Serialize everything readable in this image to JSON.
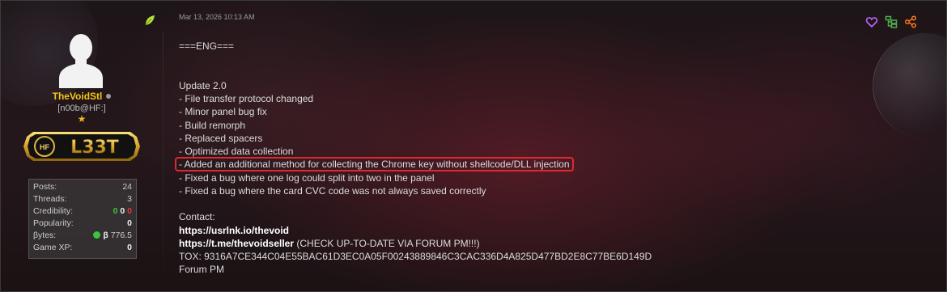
{
  "post": {
    "timestamp": "Mar 13, 2026 10:13 AM",
    "user": {
      "username": "TheVoidStl",
      "title": "[n00b@HF:]",
      "rank": "L33T",
      "rank_logo": "HF",
      "star": "★",
      "stats": [
        {
          "label": "Posts:",
          "value": "24"
        },
        {
          "label": "Threads:",
          "value": "3"
        },
        {
          "label": "Credibility:",
          "value_parts": [
            "0",
            "0",
            "0"
          ],
          "colors": [
            "#3cc43c",
            "#eeeeee",
            "#e03a3a"
          ]
        },
        {
          "label": "Popularity:",
          "value": "0"
        },
        {
          "label": "βytes:",
          "value_prefix": "β",
          "value": "776.5"
        },
        {
          "label": "Game XP:",
          "value": "0"
        }
      ]
    },
    "content": {
      "header": "===ENG===",
      "update_title": "Update 2.0",
      "changes": [
        "- File transfer protocol changed",
        "- Minor panel bug fix",
        "- Build remorph",
        "- Replaced spacers",
        "- Optimized data collection",
        "- Added an additional method for collecting the Chrome key without shellcode/DLL injection",
        "- Fixed a bug where one log could split into two in the panel",
        "- Fixed a bug where the card CVC code was not always saved correctly"
      ],
      "highlighted_index": 5,
      "contact_label": "Contact:",
      "contact_link_1": "https://usrlnk.io/thevoid",
      "contact_link_2": "https://t.me/thevoidseller",
      "contact_link_2_note": " (CHECK UP-TO-DATE VIA FORUM PM!!!)",
      "tox": "TOX: 9316A7CE344C04E55BAC61D3EC0A05F00243889846C3CAC336D4A825D477BD2E8C77BE6D149D",
      "forum_pm": "Forum PM"
    },
    "actions": [
      {
        "name": "heart-icon",
        "color": "#c266ff"
      },
      {
        "name": "tree-icon",
        "color": "#4caf50"
      },
      {
        "name": "share-icon",
        "color": "#ff7a1a"
      }
    ],
    "colors": {
      "username": "#f5c518",
      "highlight_border": "#e0282f"
    }
  }
}
